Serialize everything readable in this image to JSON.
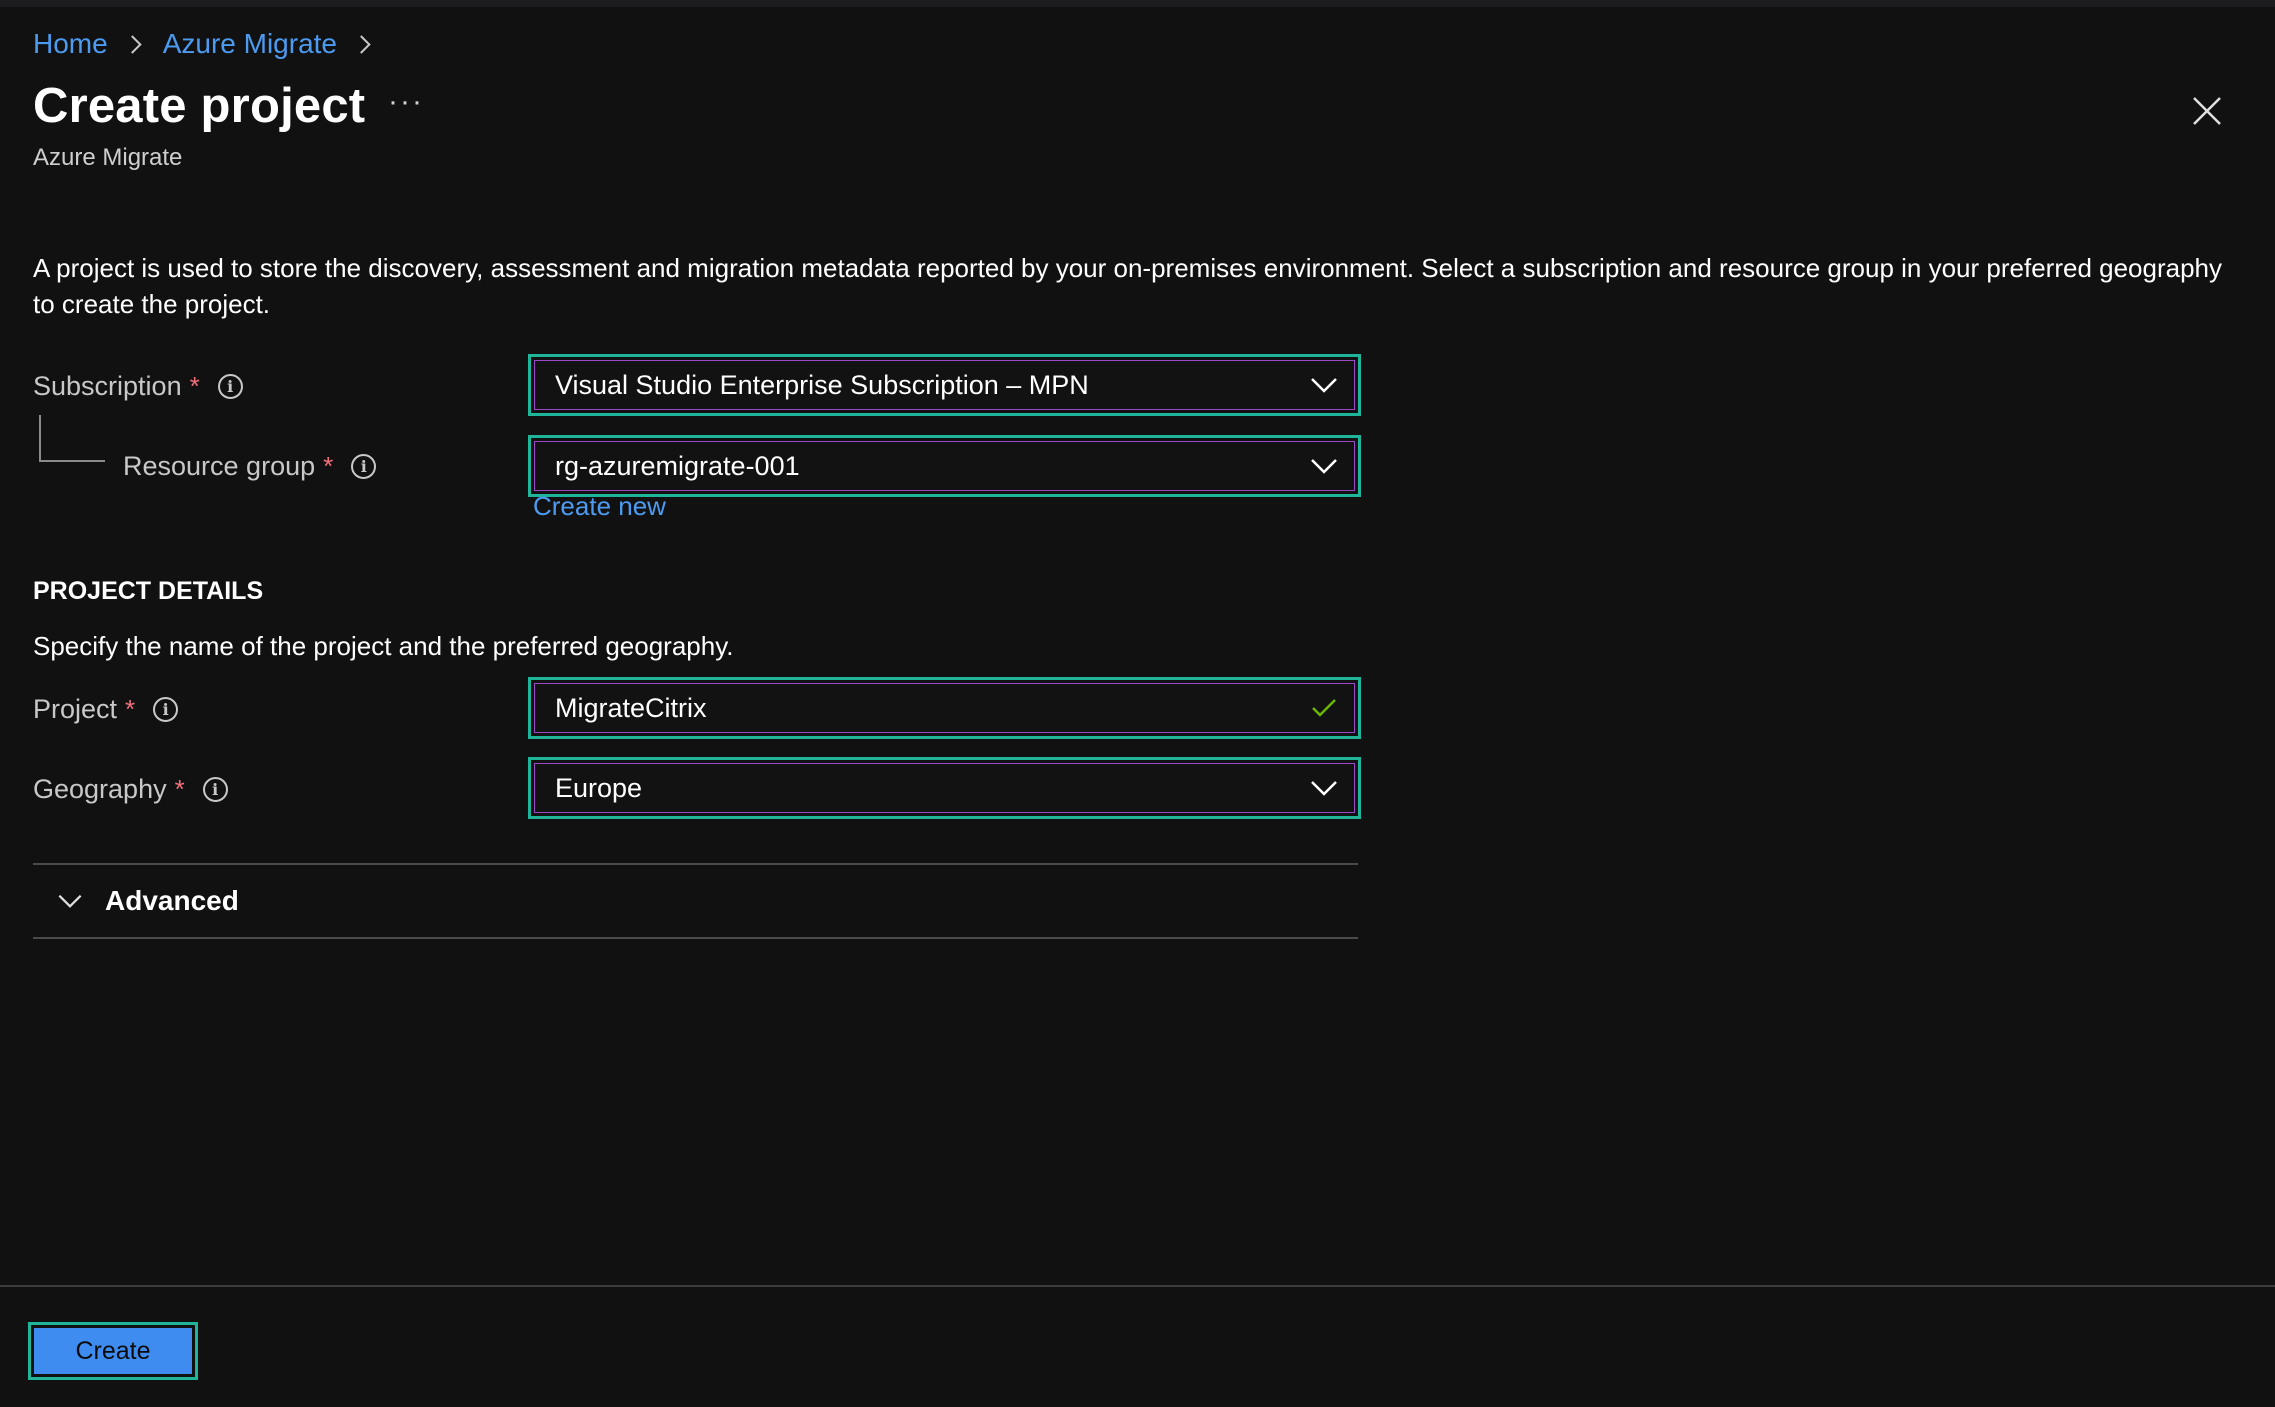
{
  "breadcrumb": {
    "items": [
      "Home",
      "Azure Migrate"
    ]
  },
  "header": {
    "title": "Create project",
    "more_label": "···",
    "subtitle": "Azure Migrate"
  },
  "description": "A project is used to store the discovery, assessment and migration metadata reported by your on-premises environment. Select a subscription and resource group in your preferred geography to create the project.",
  "fields": {
    "subscription": {
      "label": "Subscription",
      "required": "*",
      "value": "Visual Studio Enterprise Subscription – MPN"
    },
    "resource_group": {
      "label": "Resource group",
      "required": "*",
      "value": "rg-azuremigrate-001",
      "create_new": "Create new"
    },
    "project": {
      "label": "Project",
      "required": "*",
      "value": "MigrateCitrix"
    },
    "geography": {
      "label": "Geography",
      "required": "*",
      "value": "Europe"
    }
  },
  "project_details": {
    "heading": "PROJECT DETAILS",
    "description": "Specify the name of the project and the preferred geography."
  },
  "advanced": {
    "label": "Advanced"
  },
  "footer": {
    "create_label": "Create"
  },
  "icons": {
    "info": "info-icon",
    "dropdown": "chevron-down-icon",
    "valid": "checkmark-icon",
    "close": "close-icon"
  },
  "colors": {
    "link": "#4c9bf0",
    "required": "#f1707b",
    "focus_outline": "#1fb59a",
    "primary_button": "#3f8cf0",
    "valid_check": "#6bb700"
  }
}
